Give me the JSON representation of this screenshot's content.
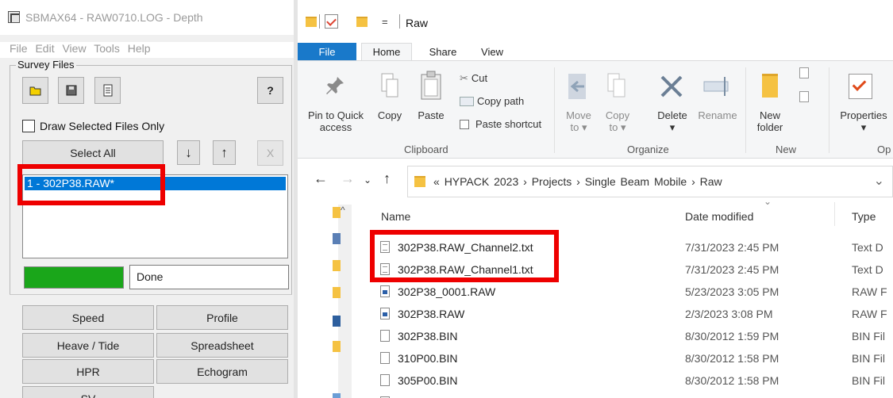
{
  "left_app": {
    "title": "SBMAX64 - RAW0710.LOG - Depth",
    "menu": [
      "File",
      "Edit",
      "View",
      "Tools",
      "Help"
    ],
    "group_label": "Survey Files",
    "help_button": "?",
    "draw_selected_label": "Draw Selected Files Only",
    "select_all_label": "Select All",
    "down_arrow": "↓",
    "up_arrow": "↑",
    "remove_label": "X",
    "file_list": [
      "1 - 302P38.RAW*"
    ],
    "status_text": "Done",
    "progress_fraction": 1.0,
    "progress_color": "#1aa61a",
    "buttons": [
      {
        "left": "Speed",
        "right": "Profile"
      },
      {
        "left": "Heave / Tide",
        "right": "Spreadsheet"
      },
      {
        "left": "HPR",
        "right": "Echogram"
      },
      {
        "left": "SV",
        "right": ""
      }
    ]
  },
  "explorer": {
    "title_dropdown": "=",
    "title": "Raw",
    "tabs": [
      "File",
      "Home",
      "Share",
      "View"
    ],
    "ribbon": {
      "pin_label": "Pin to Quick\naccess",
      "copy_label": "Copy",
      "paste_label": "Paste",
      "cut_label": "Cut",
      "copy_path_label": "Copy path",
      "paste_shortcut_label": "Paste shortcut",
      "move_to_label": "Move\nto ▾",
      "copy_to_label": "Copy\nto ▾",
      "delete_label": "Delete\n▾",
      "rename_label": "Rename",
      "new_folder_label": "New\nfolder",
      "properties_label": "Properties\n▾",
      "groups": [
        "Clipboard",
        "Organize",
        "New",
        "Op"
      ]
    },
    "address": {
      "prefix": "«",
      "crumbs": "HYPACK 2023 › Projects › Single Beam Mobile › Raw"
    },
    "columns": [
      "Name",
      "Date modified",
      "Type"
    ],
    "files": [
      {
        "name": "302P38.RAW_Channel2.txt",
        "date": "7/31/2023 2:45 PM",
        "type": "Text D"
      },
      {
        "name": "302P38.RAW_Channel1.txt",
        "date": "7/31/2023 2:45 PM",
        "type": "Text D"
      },
      {
        "name": "302P38_0001.RAW",
        "date": "5/23/2023 3:05 PM",
        "type": "RAW F"
      },
      {
        "name": "302P38.RAW",
        "date": "2/3/2023 3:08 PM",
        "type": "RAW F"
      },
      {
        "name": "302P38.BIN",
        "date": "8/30/2012 1:59 PM",
        "type": "BIN Fil"
      },
      {
        "name": "310P00.BIN",
        "date": "8/30/2012 1:58 PM",
        "type": "BIN Fil"
      },
      {
        "name": "305P00.BIN",
        "date": "8/30/2012 1:58 PM",
        "type": "BIN Fil"
      }
    ]
  },
  "colors": {
    "ribbon_file_tab": "#1979ca",
    "selection_blue": "#0078d7",
    "highlight_red": "#ee0000",
    "progress_green": "#1aa61a"
  }
}
